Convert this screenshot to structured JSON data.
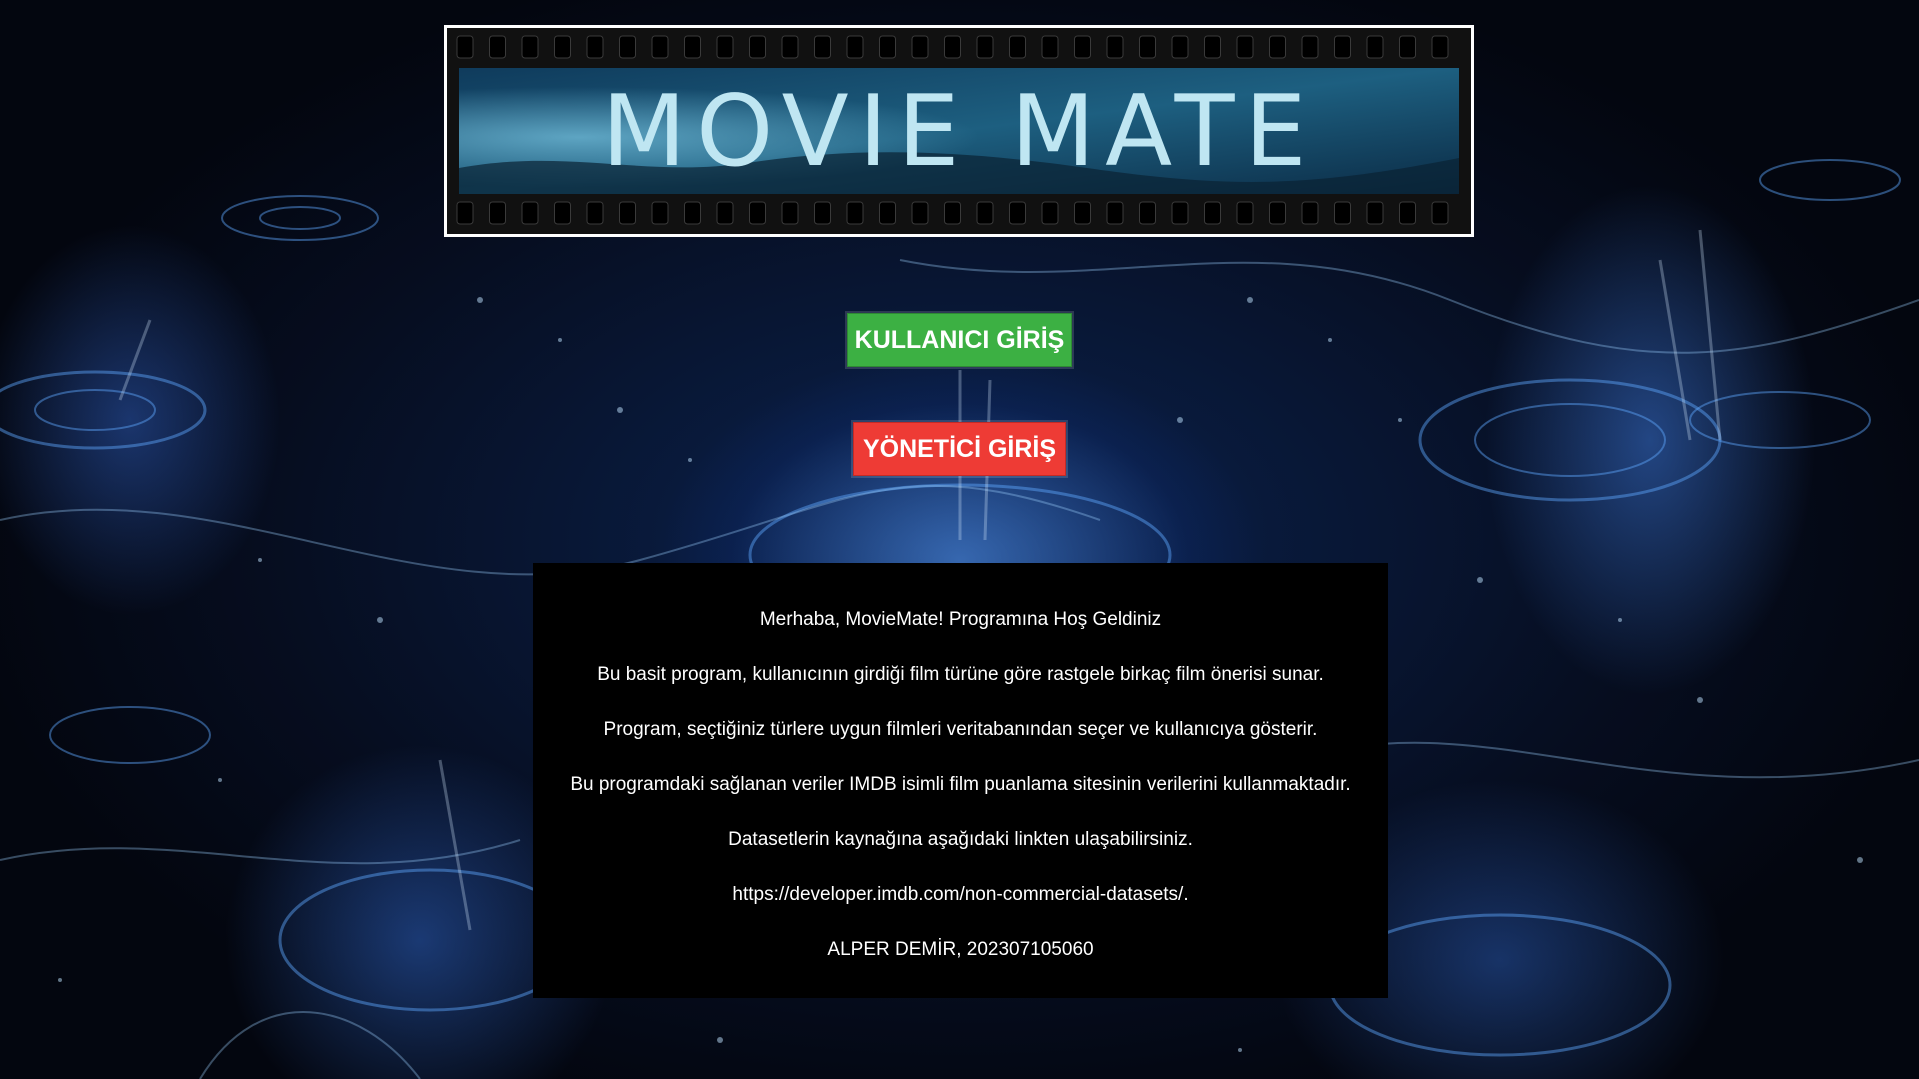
{
  "app": {
    "banner_title": "MOVIE MATE"
  },
  "buttons": {
    "user_login": "KULLANICI GİRİŞ",
    "admin_login": "YÖNETİCİ GİRİŞ"
  },
  "info": {
    "lines": [
      "Merhaba, MovieMate! Programına Hoş Geldiniz",
      "Bu basit program, kullanıcının girdiği film türüne göre rastgele birkaç film önerisi sunar.",
      "Program, seçtiğiniz türlere uygun filmleri veritabanından seçer ve kullanıcıya gösterir.",
      "Bu programdaki sağlanan veriler IMDB isimli film puanlama sitesinin verilerini kullanmaktadır.",
      "Datasetlerin kaynağına aşağıdaki linkten ulaşabilirsiniz.",
      "https://developer.imdb.com/non-commercial-datasets/.",
      "ALPER DEMİR, 202307105060"
    ]
  },
  "colors": {
    "user_button": "#3cb043",
    "admin_button": "#ee3b35",
    "panel": "#000000",
    "banner_text": "#bfe6f2"
  }
}
